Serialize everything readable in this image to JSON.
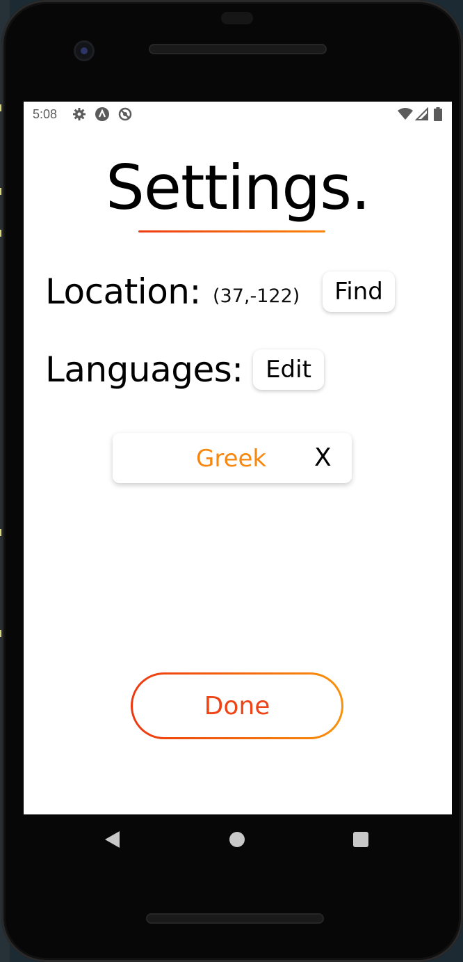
{
  "status_bar": {
    "time": "5:08",
    "left_icons": [
      "settings-gear-icon",
      "android-studio-icon",
      "sync-icon"
    ],
    "right_icons": [
      "wifi-icon",
      "signal-icon",
      "battery-icon"
    ]
  },
  "page": {
    "title": "Settings."
  },
  "location": {
    "label": "Location:",
    "value": "(37,-122)",
    "find_button_label": "Find"
  },
  "languages": {
    "label": "Languages:",
    "edit_button_label": "Edit",
    "items": [
      {
        "name": "Greek",
        "remove_label": "X"
      }
    ]
  },
  "done_button": {
    "label": "Done"
  },
  "navigation": {
    "icons": [
      "back-icon",
      "home-icon",
      "recent-apps-icon"
    ]
  },
  "colors": {
    "accent_start": "#ee3b12",
    "accent_end": "#f8870d",
    "language_text": "#f7870e"
  }
}
